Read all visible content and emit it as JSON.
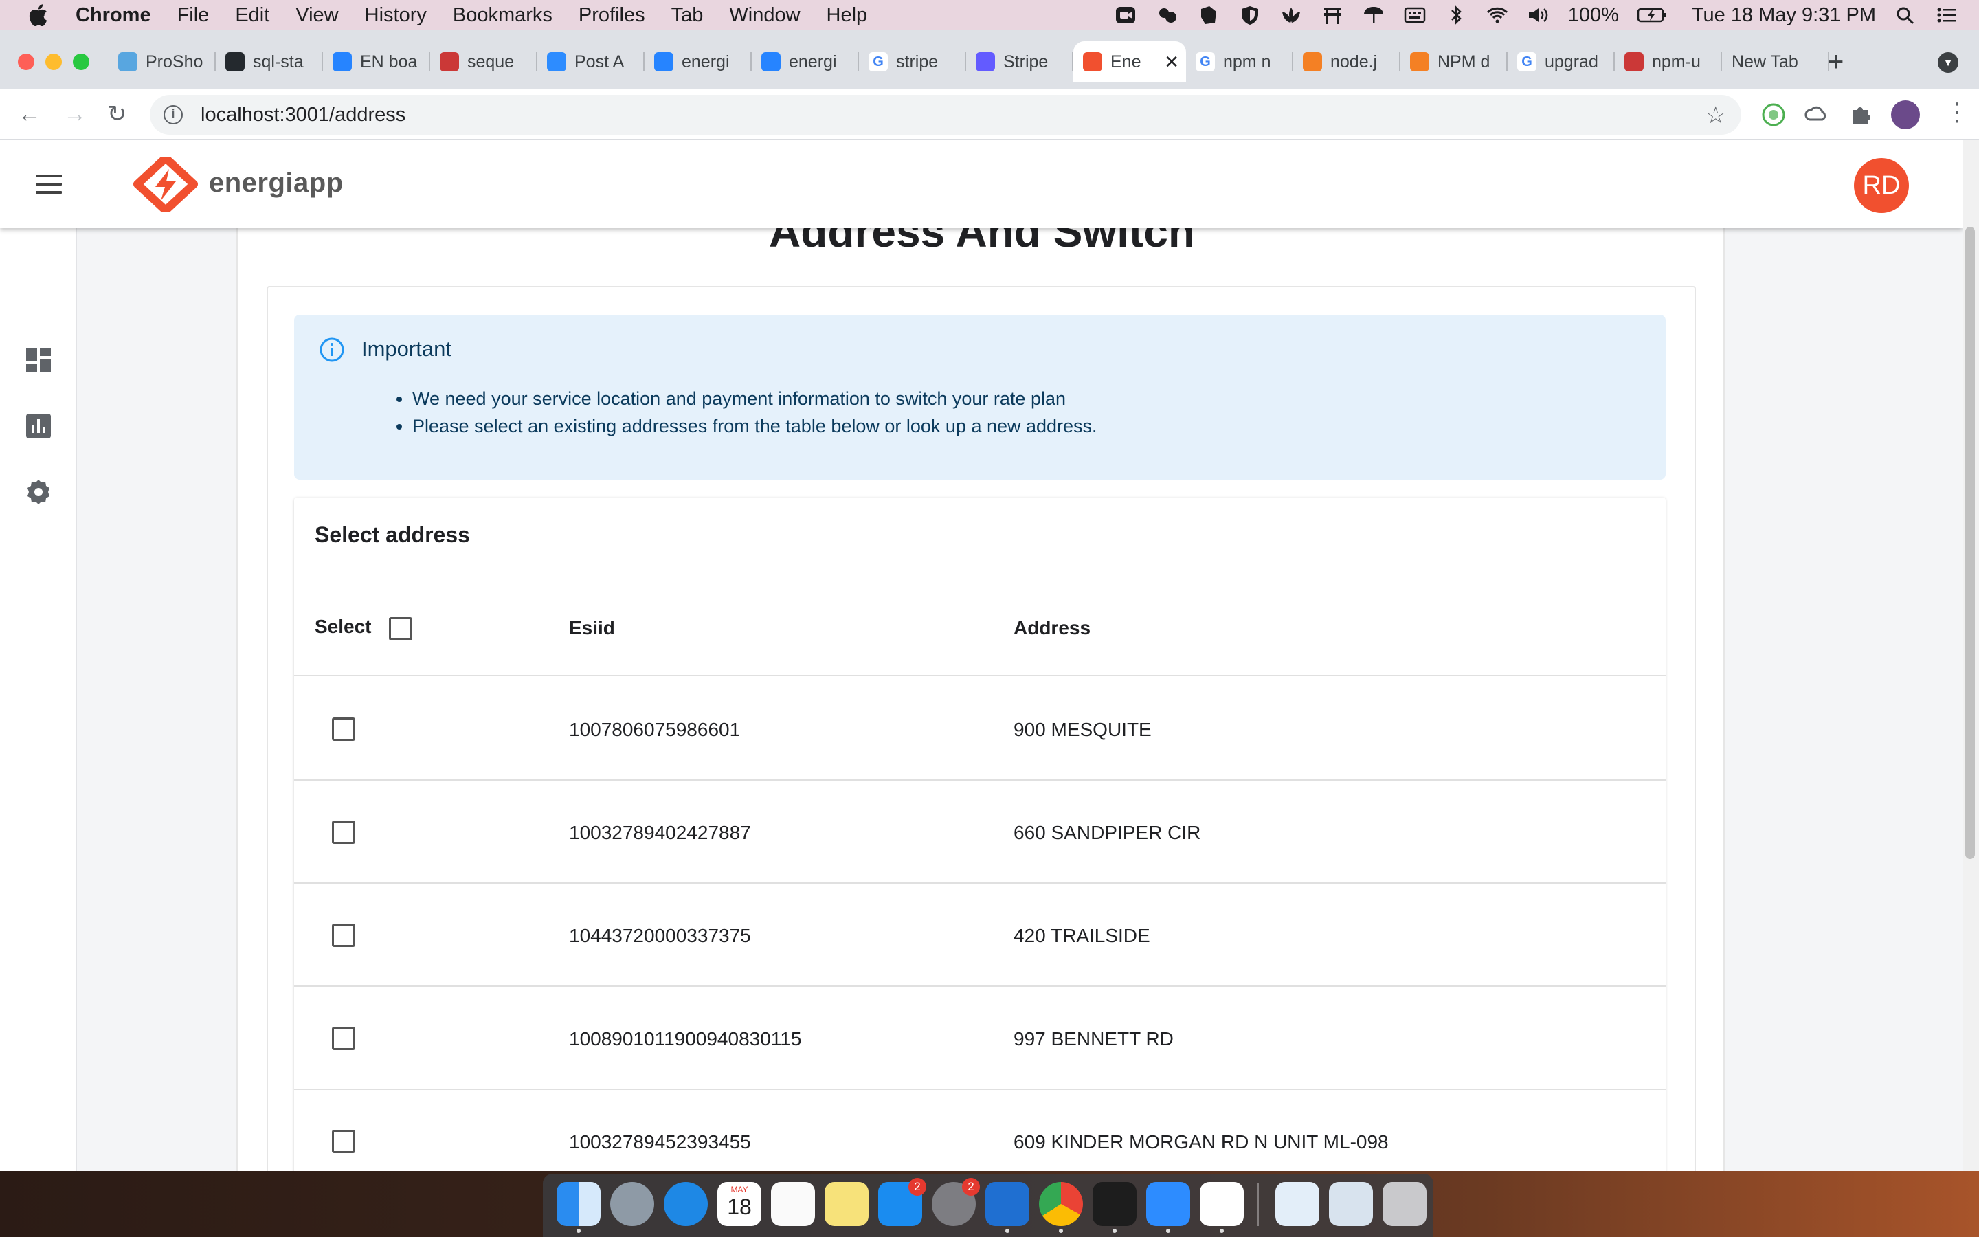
{
  "menubar": {
    "app_name": "Chrome",
    "menus": [
      "File",
      "Edit",
      "View",
      "History",
      "Bookmarks",
      "Profiles",
      "Tab",
      "Window",
      "Help"
    ],
    "battery": "100%",
    "clock": "Tue 18 May  9:31 PM"
  },
  "tabs": [
    {
      "title": "ProSho",
      "icon": "prosho-favicon",
      "color": "#58a6e0"
    },
    {
      "title": "sql-sta",
      "icon": "github-favicon",
      "color": "#24292e"
    },
    {
      "title": "EN boa",
      "icon": "jira-favicon",
      "color": "#2684ff"
    },
    {
      "title": "seque",
      "icon": "npm-favicon",
      "color": "#cb3837"
    },
    {
      "title": "Post A",
      "icon": "zoom-favicon",
      "color": "#2d8cff"
    },
    {
      "title": "energi",
      "icon": "bitbucket-favicon",
      "color": "#2684ff"
    },
    {
      "title": "energi",
      "icon": "bitbucket-favicon",
      "color": "#2684ff"
    },
    {
      "title": "stripe",
      "icon": "google-favicon",
      "color": "#ffffff"
    },
    {
      "title": "Stripe",
      "icon": "stripe-favicon",
      "color": "#635bff"
    },
    {
      "title": "Ene",
      "icon": "energiapp-favicon",
      "color": "#f1502f",
      "active": true
    },
    {
      "title": "npm n",
      "icon": "google-favicon",
      "color": "#ffffff"
    },
    {
      "title": "node.j",
      "icon": "stackoverflow-favicon",
      "color": "#f48024"
    },
    {
      "title": "NPM d",
      "icon": "stackoverflow-favicon",
      "color": "#f48024"
    },
    {
      "title": "upgrad",
      "icon": "google-favicon",
      "color": "#ffffff"
    },
    {
      "title": "npm-u",
      "icon": "npm-favicon",
      "color": "#cb3837"
    },
    {
      "title": "New Tab",
      "icon": "",
      "color": ""
    }
  ],
  "omnibox": {
    "url": "localhost:3001/address"
  },
  "app": {
    "logo_text": "energiapp",
    "avatar_initials": "RD",
    "brand_color": "#f1502f"
  },
  "page": {
    "title": "Address And Switch",
    "alert": {
      "title": "Important",
      "items": [
        "We need your service location and payment information to switch your rate plan",
        "Please select an existing addresses from the table below or look up a new address."
      ]
    },
    "table": {
      "title": "Select address",
      "columns": {
        "select": "Select",
        "esiid": "Esiid",
        "address": "Address"
      },
      "rows": [
        {
          "esiid": "1007806075986601",
          "address": "900 MESQUITE"
        },
        {
          "esiid": "10032789402427887",
          "address": "660 SANDPIPER CIR"
        },
        {
          "esiid": "10443720000337375",
          "address": "420 TRAILSIDE"
        },
        {
          "esiid": "1008901011900940830115",
          "address": "997 BENNETT RD"
        },
        {
          "esiid": "10032789452393455",
          "address": "609 KINDER MORGAN RD N UNIT ML-098"
        }
      ]
    }
  },
  "dock": {
    "calendar_month": "MAY",
    "calendar_day": "18",
    "appstore_badge": "2",
    "settings_badge": "2"
  }
}
